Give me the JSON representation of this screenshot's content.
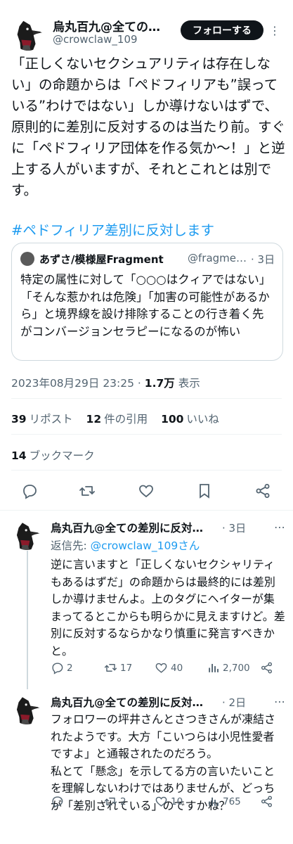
{
  "main_tweet": {
    "author_name": "烏丸百九@全ての…",
    "author_handle": "@crowclaw_109",
    "follow_label": "フォローする",
    "text": "「正しくないセクシュアリティは存在しない」の命題からは「ペドフィリアも”誤っている”わけではない」しか導けないはずで、原則的に差別に反対するのは当たり前。すぐに「ペドフィリア団体を作る気か〜！」と逆上する人がいますが、それとこれとは別です。",
    "hashtag": "#ペドフィリア差別に反対します",
    "timestamp": "2023年08月29日 23:25",
    "views_count": "1.7万",
    "views_label": "表示",
    "reposts_count": "39",
    "reposts_label": "リポスト",
    "quotes_count": "12",
    "quotes_label": "件の引用",
    "likes_count": "100",
    "likes_label": "いいね",
    "bookmarks_count": "14",
    "bookmarks_label": "ブックマーク"
  },
  "quoted_tweet": {
    "author_name": "あずさ/模様屋Fragment",
    "author_handle": "@fragme…",
    "date": "3日",
    "text": "特定の属性に対して「○○○はクィアではない」「そんな惹かれは危険」「加害の可能性があるから」と境界線を設け排除することの行き着く先がコンバージョンセラピーになるのが怖い"
  },
  "replies": [
    {
      "author_name": "烏丸百九@全ての差別に反対…",
      "date": "3日",
      "reply_to_prefix": "返信先: ",
      "reply_to_handle": "@crowclaw_109さん",
      "text": "逆に言いますと「正しくないセクシャリティもあるはずだ」の命題からは最終的には差別しか導けませんよ。上のタグにヘイターが集まってるとこからも明らかに見えますけど。差別に反対するならかなり慎重に発言すべきかと。",
      "replies": "2",
      "reposts": "17",
      "likes": "40",
      "views": "2,700"
    },
    {
      "author_name": "烏丸百九@全ての差別に反対…",
      "date": "2日",
      "text": "フォロワーの坪井さんとさつきさんが凍結されたようです。大方「こいつらは小児性愛者ですよ」と通報されたのだろう。\n私とて「懸念」を示してる方の言いたいことを理解しないわけではありませんが、どっちが「差別されている」のですかね？",
      "replies": "",
      "reposts": "2",
      "likes": "10",
      "views": "765"
    }
  ],
  "colors": {
    "accent": "#1d9bf0",
    "text": "#0f1419",
    "muted": "#536471",
    "border": "#cfd9de"
  }
}
